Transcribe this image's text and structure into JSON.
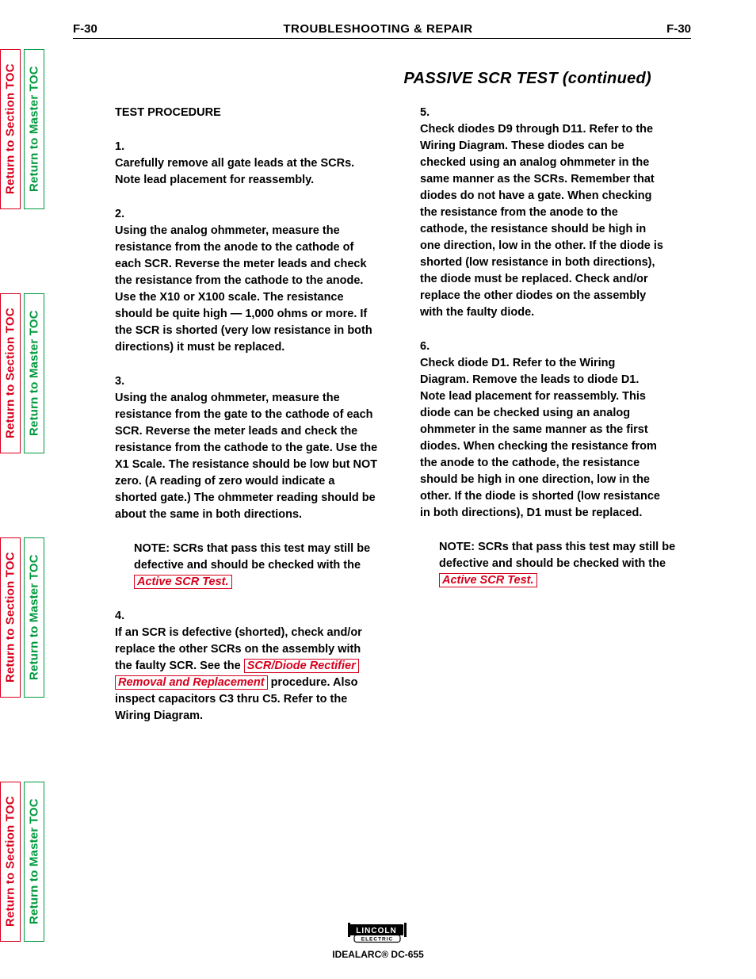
{
  "header": {
    "page_code": "F-30",
    "title": "TROUBLESHOOTING & REPAIR"
  },
  "toc": {
    "section_label": "Return to Section TOC",
    "master_label": "Return to Master TOC"
  },
  "subtitle": {
    "test_name": "PASSIVE SCR TEST",
    "continued": "(continued)"
  },
  "left_column": {
    "procedure_heading": "TEST PROCEDURE",
    "step1_num": "1.",
    "step1": "Carefully remove all gate leads at the SCRs. Note lead placement for reassembly.",
    "step2_num": "2.",
    "step2": "Using the analog ohmmeter, measure the resistance from the anode to the cathode of each SCR. Reverse the meter leads and check the resistance from the cathode to the anode. Use the X10 or X100 scale. The resistance should be quite high — 1,000 ohms or more. If the SCR is shorted (very low resistance in both directions) it must be replaced.",
    "step3_num": "3.",
    "step3": "Using the analog ohmmeter, measure the resistance from the gate to the cathode of each SCR. Reverse the meter leads and check the resistance from the cathode to the gate. Use the X1 Scale. The resistance should be low but NOT zero. (A reading of zero would indicate a shorted gate.) The ohmmeter reading should be about the same in both directions.",
    "note_head": "NOTE:",
    "note_body": " SCRs that pass this test may still be defective and should be checked with the ",
    "link_active": "Active SCR Test.",
    "step4_num": "4.",
    "step4_a": "If an SCR is defective (shorted), check and/or replace the other SCRs on the assembly with the faulty SCR. See the ",
    "link_rectifier_a": "SCR/Diode Rectifier",
    "link_rectifier_b": "Removal and Replacement",
    "step4_b": " procedure. Also inspect capacitors C3 thru C5. Refer to the Wiring Diagram."
  },
  "right_column": {
    "step5_num": "5.",
    "step5": "Check diodes D9 through D11. Refer to the Wiring Diagram. These diodes can be checked using an analog ohmmeter in the same manner as the SCRs. Remember that diodes do not have a gate. When checking the resistance from the anode to the cathode, the resistance should be high in one direction, low in the other. If the diode is shorted (low resistance in both directions), the diode must be replaced. Check and/or replace the other diodes on the assembly with the faulty diode.",
    "step6_num": "6.",
    "step6": "Check diode D1. Refer to the Wiring Diagram. Remove the leads to diode D1. Note lead placement for reassembly. This diode can be checked using an analog ohmmeter in the same manner as the first diodes. When checking the resistance from the anode to the cathode, the resistance should be high in one direction, low in the other. If the diode is shorted (low resistance in both directions), D1 must be replaced.",
    "note_head": "NOTE:",
    "note_body": " SCRs that pass this test may still be defective and should be checked with the ",
    "link_active": "Active SCR Test."
  },
  "footer": {
    "model": "IDEALARC® DC-655",
    "logo_top": "LINCOLN",
    "logo_bottom": "ELECTRIC"
  }
}
